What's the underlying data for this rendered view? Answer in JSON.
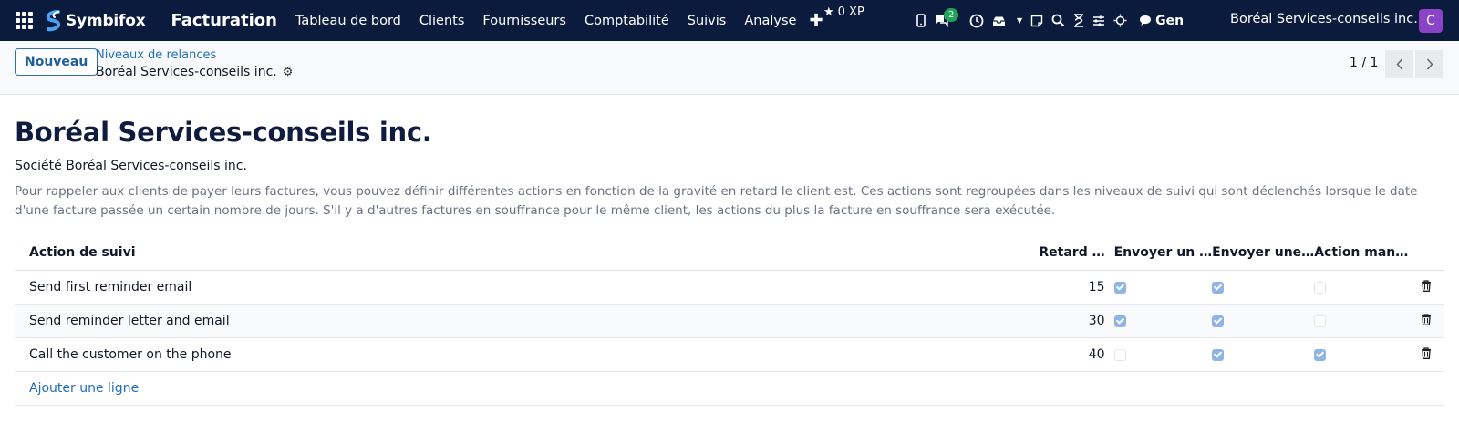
{
  "navbar": {
    "brand": "Symbifox",
    "app_title": "Facturation",
    "menu": [
      "Tableau de bord",
      "Clients",
      "Fournisseurs",
      "Comptabilité",
      "Suivis",
      "Analyse"
    ],
    "xp": "0 XP",
    "messages_badge": "2",
    "gen_label": "Gen",
    "company": "Boréal Services-conseils inc.",
    "avatar_letter": "C",
    "icons": [
      "apps-grid-icon",
      "phone-icon",
      "chat-icon",
      "clock-icon",
      "inbox-icon",
      "chevron-down-icon",
      "sticky-note-icon",
      "search-icon",
      "hourglass-icon",
      "sliders-icon",
      "sun-icon",
      "speech-bubble-icon"
    ]
  },
  "control": {
    "new_button": "Nouveau",
    "breadcrumb": "Niveaux de relances",
    "record": "Boréal Services-conseils inc.",
    "pager": "1 / 1"
  },
  "form": {
    "title": "Boréal Services-conseils inc.",
    "company_line": "Société Boréal Services-conseils inc.",
    "description": "Pour rappeler aux clients de payer leurs factures, vous pouvez définir différentes actions en fonction de la gravité en retard le client est. Ces actions sont regroupées dans les niveaux de suivi qui sont déclenchés lorsque le date d'une facture passée un certain nombre de jours. S'il y a d'autres factures en souffrance pour le même client, les actions du plus la facture en souffrance sera exécutée."
  },
  "table": {
    "headers": [
      "Action de suivi",
      "Retard …",
      "Envoyer un …",
      "Envoyer une…",
      "Action man…"
    ],
    "rows": [
      {
        "action": "Send first reminder email",
        "delay": "15",
        "email": true,
        "letter": true,
        "manual": false
      },
      {
        "action": "Send reminder letter and email",
        "delay": "30",
        "email": true,
        "letter": true,
        "manual": false
      },
      {
        "action": "Call the customer on the phone",
        "delay": "40",
        "email": false,
        "letter": true,
        "manual": true
      }
    ],
    "add_line": "Ajouter une ligne"
  },
  "colors": {
    "navbar_bg": "#0b1b3d",
    "accent": "#1f6fb8",
    "avatar": "#8b43c8",
    "badge": "#22a35a"
  }
}
